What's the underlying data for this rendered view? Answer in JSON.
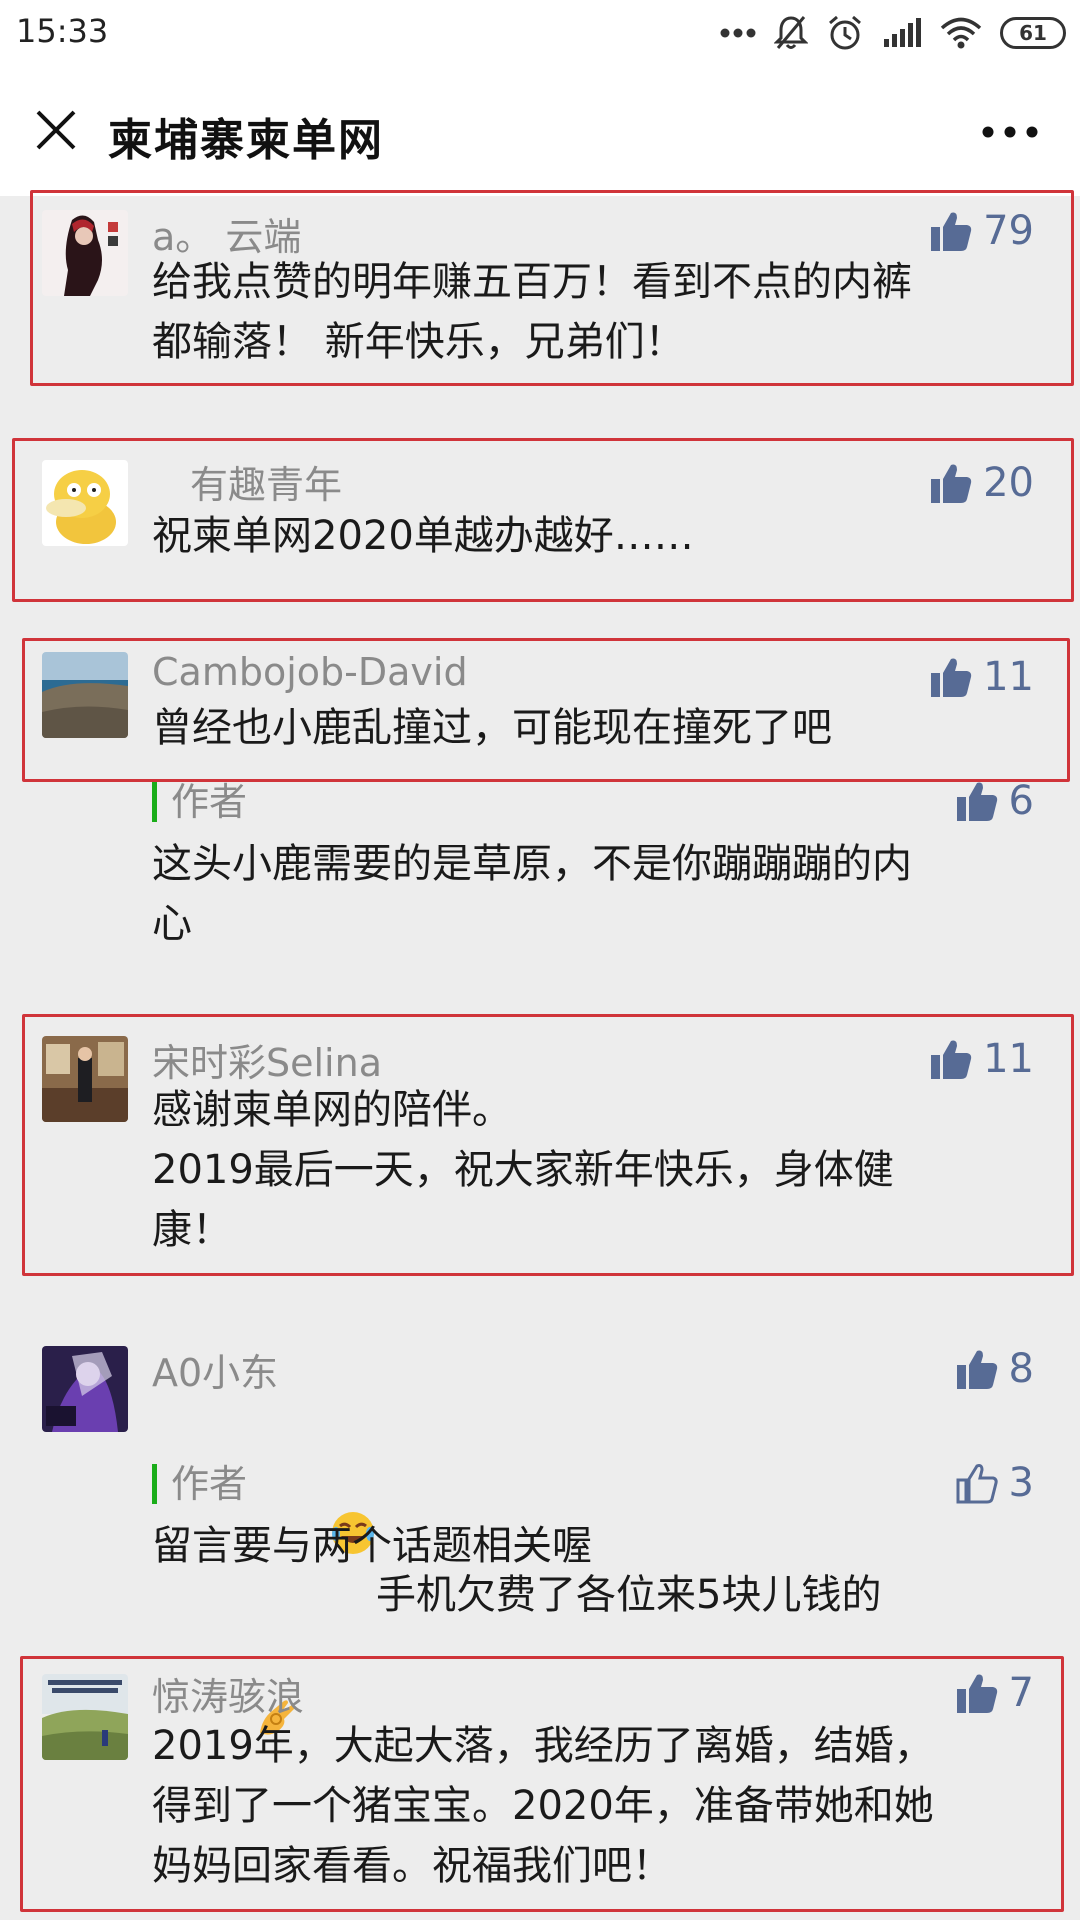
{
  "status_bar": {
    "time": "15:33",
    "battery": "61",
    "icons": [
      "more-dots-icon",
      "mute-bell-icon",
      "alarm-icon",
      "signal-icon",
      "wifi-icon",
      "battery-icon"
    ]
  },
  "nav": {
    "title": "柬埔寨柬单网",
    "close_icon": "close-icon",
    "more_icon": "more-icon"
  },
  "colors": {
    "like_blue": "#576b95",
    "highlight_red": "#d0343a",
    "author_green": "#1aad19",
    "nick_gray": "#8a8a8a",
    "background": "#ededed"
  },
  "comments": [
    {
      "nickname": "a。 云端",
      "likes": "79",
      "text": "给我点赞的明年赚五百万！看到不点的内裤\n都输落！ 新年快乐，兄弟们！",
      "highlighted": true
    },
    {
      "nickname": "有趣青年",
      "likes": "20",
      "text": "祝柬单网2020单越办越好……",
      "highlighted": true
    },
    {
      "nickname": "Cambojob-David",
      "likes": "11",
      "text": "曾经也小鹿乱撞过，可能现在撞死了吧",
      "highlighted": true,
      "reply": {
        "label": "作者",
        "likes": "6",
        "text": "这头小鹿需要的是草原，不是你蹦蹦蹦的内\n心"
      }
    },
    {
      "nickname": "宋时彩Selina",
      "likes": "11",
      "text": "感谢柬单网的陪伴。\n2019最后一天，祝大家新年快乐，身体健\n康！",
      "highlighted": true
    },
    {
      "nickname": "A0小东",
      "likes": "8",
      "text": "手机欠费了各位来5块儿钱的",
      "emoji_before": "laughing-tears-emoji",
      "emoji_after": "ok-hand-emoji",
      "highlighted": false,
      "reply": {
        "label": "作者",
        "likes": "3",
        "liked": false,
        "text": "留言要与两个话题相关喔"
      }
    },
    {
      "nickname": "惊涛骇浪",
      "likes": "7",
      "text": "2019年，大起大落，我经历了离婚，结婚，\n得到了一个猪宝宝。2020年，准备带她和她\n妈妈回家看看。祝福我们吧！",
      "highlighted": true
    }
  ]
}
